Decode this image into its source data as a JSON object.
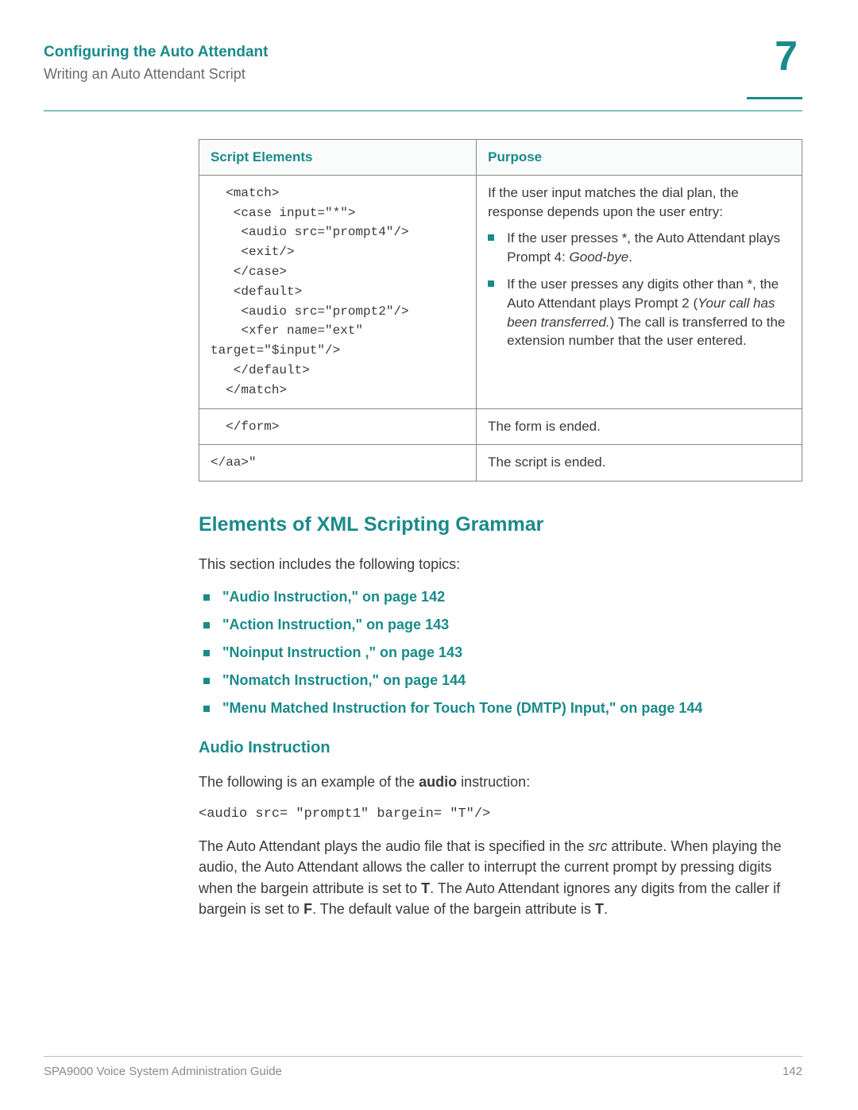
{
  "header": {
    "title": "Configuring the Auto Attendant",
    "subtitle": "Writing an Auto Attendant Script",
    "chapter": "7"
  },
  "table": {
    "col1_header": "Script Elements",
    "col2_header": "Purpose",
    "rows": [
      {
        "script": "  <match>\n   <case input=\"*\">\n    <audio src=\"prompt4\"/>\n    <exit/>\n   </case>\n   <default>\n    <audio src=\"prompt2\"/>\n    <xfer name=\"ext\"\ntarget=\"$input\"/>\n   </default>\n  </match>",
        "purpose_intro": "If the user input matches the dial plan, the response depends upon the user entry:",
        "bullets": [
          {
            "pre": "If the user presses *, the Auto Attendant plays Prompt 4: ",
            "italic": "Good-bye",
            "post": "."
          },
          {
            "pre": "If the user presses any digits other than *, the Auto Attendant plays Prompt 2 (",
            "italic": "Your call has been transferred.",
            "post": ") The call is transferred to the extension number that the user entered."
          }
        ]
      },
      {
        "script": "  </form>",
        "purpose_plain": "The form is ended."
      },
      {
        "script": "</aa>\"",
        "purpose_plain": "The script is ended."
      }
    ]
  },
  "section": {
    "title": "Elements of XML Scripting Grammar",
    "intro": "This section includes the following topics:",
    "topics": [
      "\"Audio Instruction,\" on page 142",
      "\"Action Instruction,\" on page 143",
      "\"Noinput Instruction ,\" on page 143",
      "\"Nomatch Instruction,\" on page 144",
      "\"Menu Matched Instruction for Touch Tone (DMTP) Input,\" on page 144"
    ]
  },
  "subsection": {
    "title": "Audio Instruction",
    "intro_pre": "The following is an example of the ",
    "intro_bold": "audio",
    "intro_post": " instruction:",
    "code": "<audio src= \"prompt1\" bargein= \"T\"/>",
    "para_parts": {
      "p1": "The Auto Attendant plays the audio file that is specified in the ",
      "i1": "src",
      "p2": " attribute. When playing the audio, the Auto Attendant allows the caller to interrupt the current prompt by pressing digits when the bargein attribute is set to ",
      "b1": "T",
      "p3": ". The Auto Attendant ignores any digits from the caller if bargein is set to ",
      "b2": "F",
      "p4": ". The default value of the bargein attribute is ",
      "b3": "T",
      "p5": "."
    }
  },
  "footer": {
    "left": "SPA9000 Voice System Administration Guide",
    "right": "142"
  }
}
